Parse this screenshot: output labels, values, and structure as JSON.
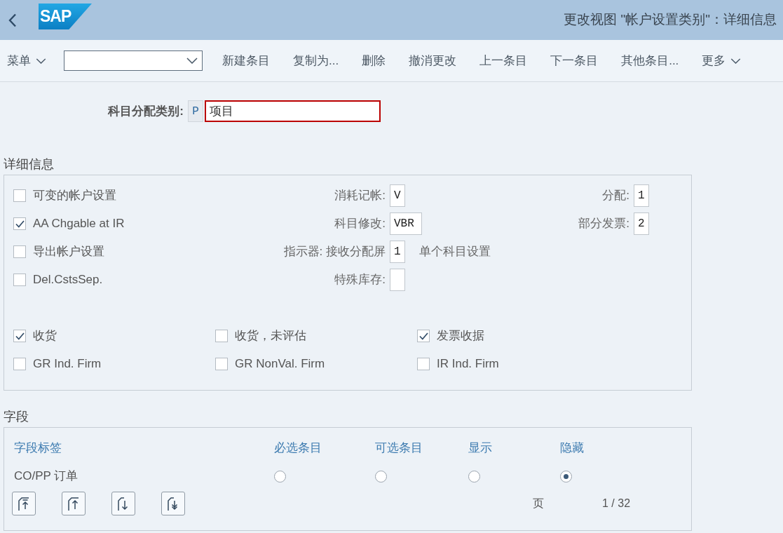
{
  "header": {
    "logo": "SAP",
    "title": "更改视图 \"帐户设置类别\"：详细信息"
  },
  "toolbar": {
    "items": [
      {
        "kind": "menu",
        "label": "菜单"
      },
      {
        "kind": "dropdown"
      },
      {
        "kind": "button",
        "label": "新建条目"
      },
      {
        "kind": "button",
        "label": "复制为..."
      },
      {
        "kind": "button",
        "label": "删除"
      },
      {
        "kind": "button",
        "label": "撤消更改"
      },
      {
        "kind": "button",
        "label": "上一条目"
      },
      {
        "kind": "button",
        "label": "下一条目"
      },
      {
        "kind": "button",
        "label": "其他条目..."
      },
      {
        "kind": "menu",
        "label": "更多"
      }
    ]
  },
  "key_field": {
    "label": "科目分配类别:",
    "code": "P",
    "value": "项目"
  },
  "details": {
    "title": "详细信息",
    "rows": [
      {
        "checkbox": {
          "label": "可变的帐户设置",
          "checked": false
        },
        "field": {
          "label": "消耗记帐:",
          "value": "V"
        },
        "right_field": {
          "label": "分配:",
          "value": "1"
        }
      },
      {
        "checkbox": {
          "label": "AA Chgable at IR",
          "checked": true
        },
        "field": {
          "label": "科目修改:",
          "value": "VBR"
        },
        "right_field": {
          "label": "部分发票:",
          "value": "2"
        }
      },
      {
        "checkbox": {
          "label": "导出帐户设置",
          "checked": false
        },
        "field": {
          "label": "指示器: 接收分配屏",
          "value": "1",
          "note": "单个科目设置"
        }
      },
      {
        "checkbox": {
          "label": "Del.CstsSep.",
          "checked": false
        },
        "field": {
          "label": "特殊库存:"
        }
      }
    ],
    "flags": [
      {
        "label": "收货",
        "checked": true
      },
      {
        "label": "收货，未评估",
        "checked": false
      },
      {
        "label": "发票收据",
        "checked": true
      },
      {
        "label": "GR Ind. Firm",
        "checked": false
      },
      {
        "label": "GR NonVal. Firm",
        "checked": false
      },
      {
        "label": "IR Ind. Firm",
        "checked": false
      }
    ]
  },
  "fields": {
    "title": "字段",
    "columns": [
      "字段标签",
      "必选条目",
      "可选条目",
      "显示",
      "隐藏"
    ],
    "rows": [
      {
        "label": "CO/PP 订单",
        "options": [
          {
            "selected": false
          },
          {
            "selected": false
          },
          {
            "selected": false
          },
          {
            "selected": true
          }
        ]
      }
    ],
    "pager": {
      "label": "页",
      "page": "1 / 32"
    }
  }
}
